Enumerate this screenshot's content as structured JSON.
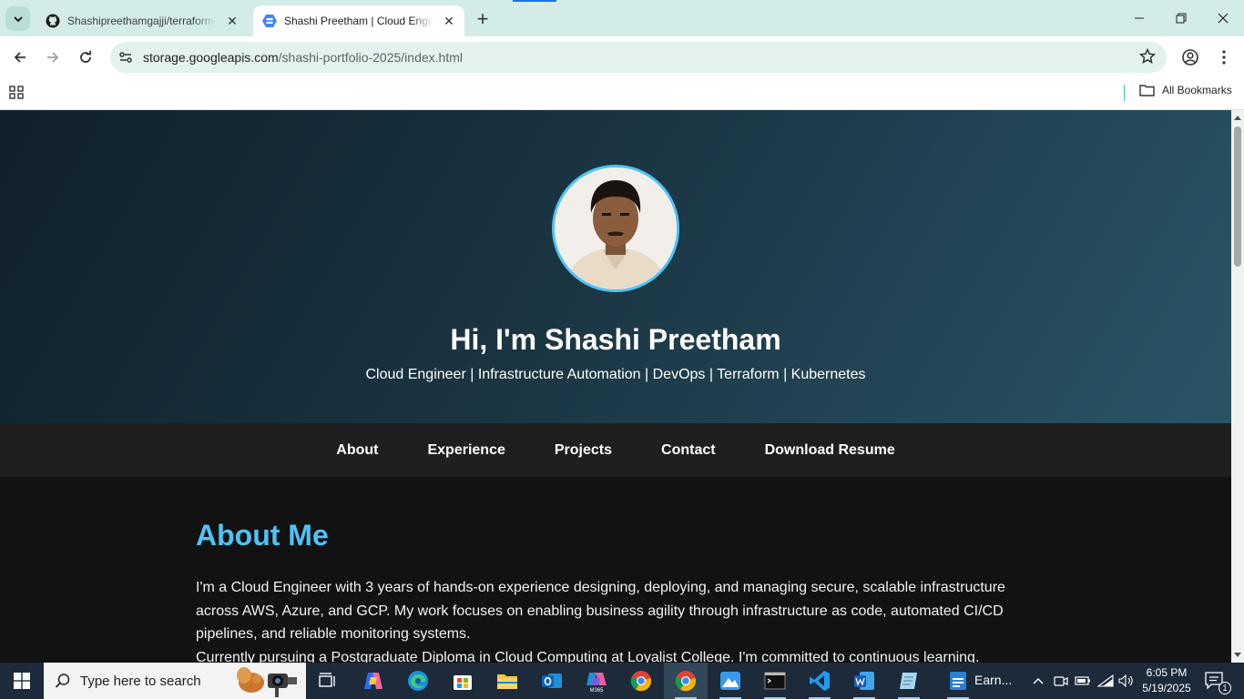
{
  "browser": {
    "tabs": [
      {
        "title": "Shashipreethamgajji/terraform-",
        "icon": "github-icon",
        "active": false
      },
      {
        "title": "Shashi Preetham | Cloud Engineer",
        "icon": "google-cloud-storage-icon",
        "active": true
      }
    ],
    "url": {
      "host": "storage.googleapis.com",
      "path": "/shashi-portfolio-2025/index.html"
    },
    "bookmarks": {
      "all_label": "All Bookmarks"
    }
  },
  "page": {
    "hero": {
      "title": "Hi, I'm Shashi Preetham",
      "subtitle": "Cloud Engineer | Infrastructure Automation | DevOps | Terraform | Kubernetes"
    },
    "nav": [
      "About",
      "Experience",
      "Projects",
      "Contact",
      "Download Resume"
    ],
    "about": {
      "heading": "About Me",
      "paragraph1": "I'm a Cloud Engineer with 3 years of hands-on experience designing, deploying, and managing secure, scalable infrastructure across AWS, Azure, and GCP. My work focuses on enabling business agility through infrastructure as code, automated CI/CD pipelines, and reliable monitoring systems.",
      "paragraph2": "Currently pursuing a Postgraduate Diploma in Cloud Computing at Loyalist College. I'm committed to continuous learning."
    },
    "colors": {
      "accent": "#4fc3f7",
      "nav_bg": "#1f1f1f",
      "body_bg": "#121212"
    }
  },
  "taskbar": {
    "search_placeholder": "Type here to search",
    "earn_label": "Earn...",
    "clock": {
      "time": "6:05 PM",
      "date": "5/19/2025"
    },
    "notification_count": "1",
    "apps": [
      "task-view-icon",
      "copilot-icon",
      "edge-icon",
      "store-icon",
      "file-explorer-icon",
      "outlook-icon",
      "m365-icon",
      "chrome-icon",
      "chrome-active-icon",
      "photos-icon",
      "terminal-icon",
      "vscode-icon",
      "word-icon",
      "notepad-icon",
      "earn-icon"
    ]
  }
}
